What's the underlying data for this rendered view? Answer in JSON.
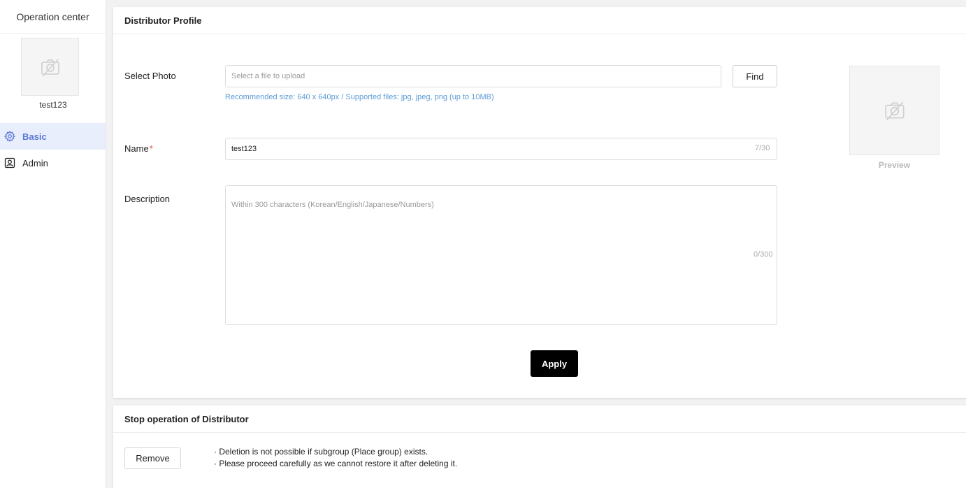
{
  "sidebar": {
    "title": "Operation center",
    "username": "test123",
    "items": [
      {
        "label": "Basic",
        "icon": "gear-icon",
        "active": true
      },
      {
        "label": "Admin",
        "icon": "user-badge-icon",
        "active": false
      }
    ]
  },
  "profile": {
    "title": "Distributor Profile",
    "photo_label": "Select Photo",
    "photo_placeholder": "Select a file to upload",
    "find_label": "Find",
    "photo_hint": "Recommended size: 640 x 640px / Supported files: jpg, jpeg, png (up to 10MB)",
    "name_label": "Name",
    "name_required": "*",
    "name_value": "test123",
    "name_counter": "7/30",
    "description_label": "Description",
    "description_placeholder": "Within 300 characters (Korean/English/Japanese/Numbers)",
    "description_counter": "0/300",
    "preview_label": "Preview",
    "apply_label": "Apply"
  },
  "stop": {
    "title": "Stop operation of Distributor",
    "remove_label": "Remove",
    "notes": [
      "· Deletion is not possible if subgroup (Place group) exists.",
      "· Please proceed carefully as we cannot restore it after deleting it."
    ]
  },
  "colors": {
    "accent": "#5b78d6",
    "active_bg": "#e9eefc",
    "hint": "#5b9bd5",
    "required": "#e34b4b",
    "primary_button": "#000000"
  }
}
